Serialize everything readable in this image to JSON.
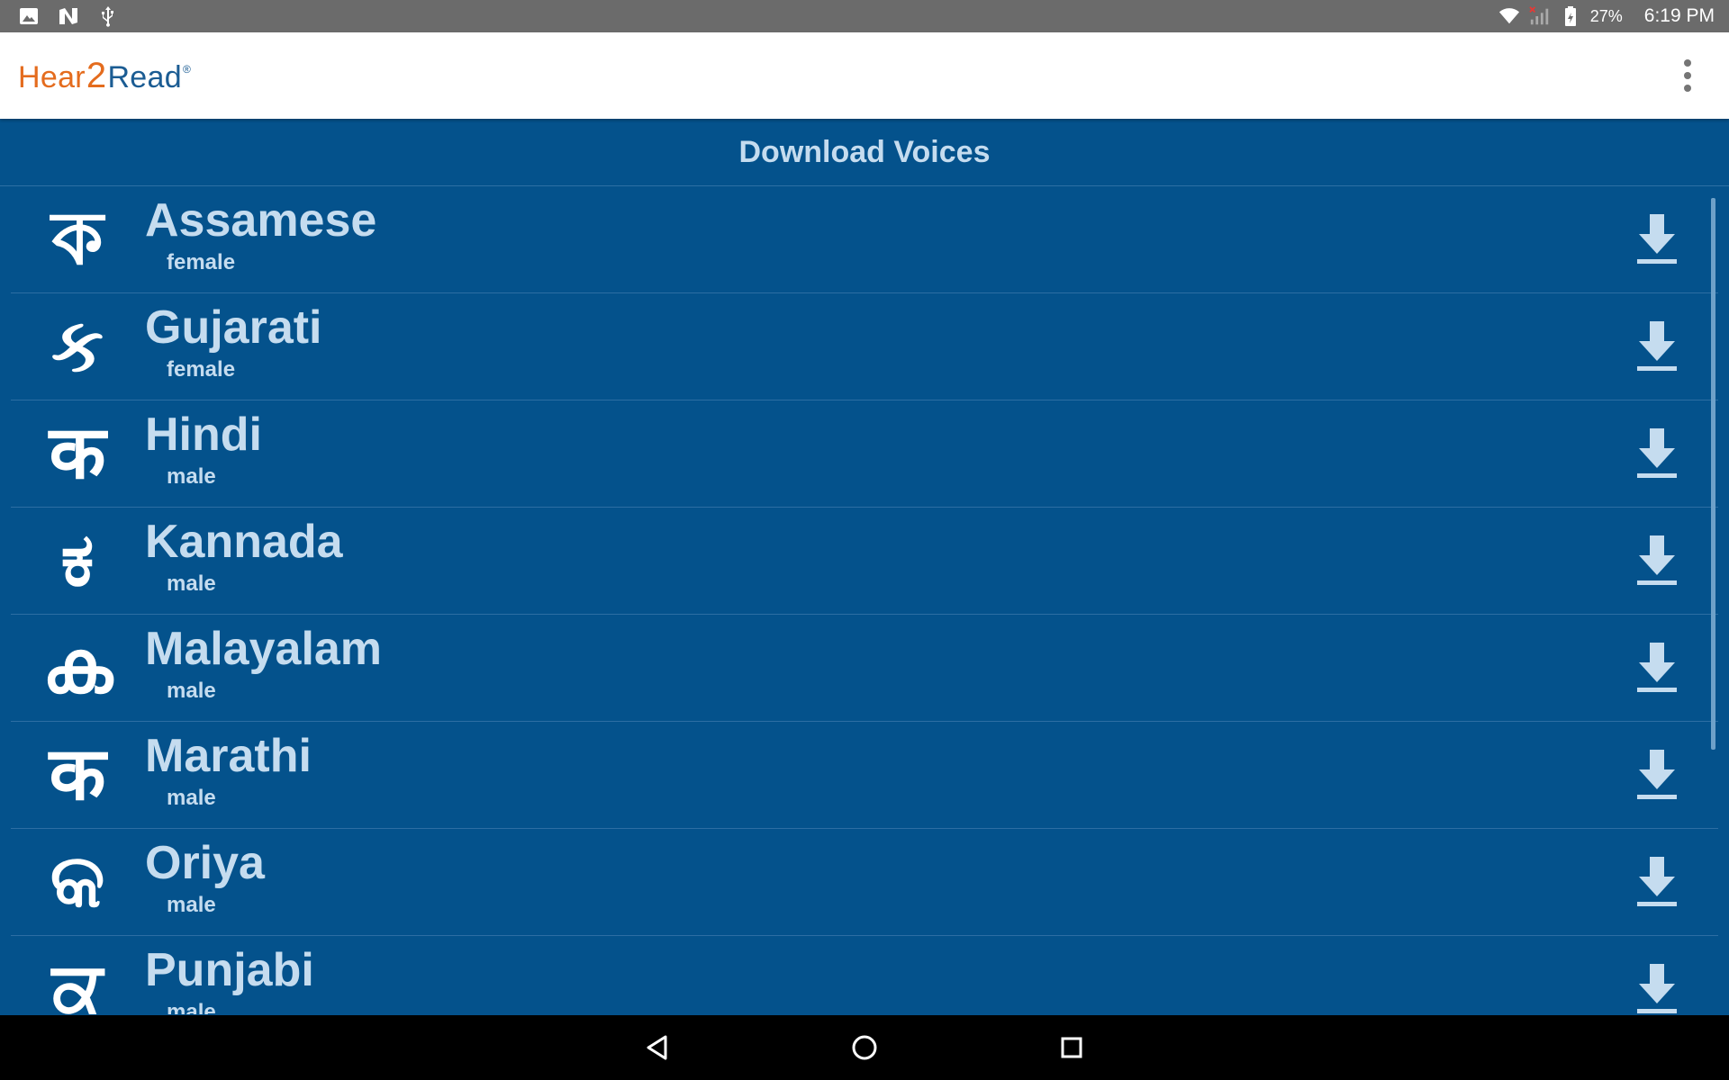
{
  "status_bar": {
    "battery": "27%",
    "time": "6:19 PM",
    "icons": [
      "image-notification-icon",
      "n-notification-icon",
      "usb-icon",
      "wifi-icon",
      "signal-icon",
      "battery-icon"
    ]
  },
  "app_bar": {
    "logo": {
      "part1": "Hear",
      "part2": "2",
      "part3": "Read",
      "mark": "®"
    },
    "menu_icon": "overflow-menu-icon"
  },
  "header": {
    "title": "Download Voices"
  },
  "voices": [
    {
      "glyph": "ক",
      "name": "Assamese",
      "gender": "female"
    },
    {
      "glyph": "ક",
      "name": "Gujarati",
      "gender": "female"
    },
    {
      "glyph": "क",
      "name": "Hindi",
      "gender": "male"
    },
    {
      "glyph": "ಕ",
      "name": "Kannada",
      "gender": "male"
    },
    {
      "glyph": "ക",
      "name": "Malayalam",
      "gender": "male"
    },
    {
      "glyph": "क",
      "name": "Marathi",
      "gender": "male"
    },
    {
      "glyph": "କ",
      "name": "Oriya",
      "gender": "male"
    },
    {
      "glyph": "ਕ",
      "name": "Punjabi",
      "gender": "male"
    }
  ],
  "colors": {
    "background": "#04528c",
    "text": "#c5dcef",
    "logo_orange": "#e46c1e",
    "logo_blue": "#1b5c93"
  },
  "nav_bar": {
    "icons": [
      "back-icon",
      "home-icon",
      "recents-icon"
    ]
  }
}
